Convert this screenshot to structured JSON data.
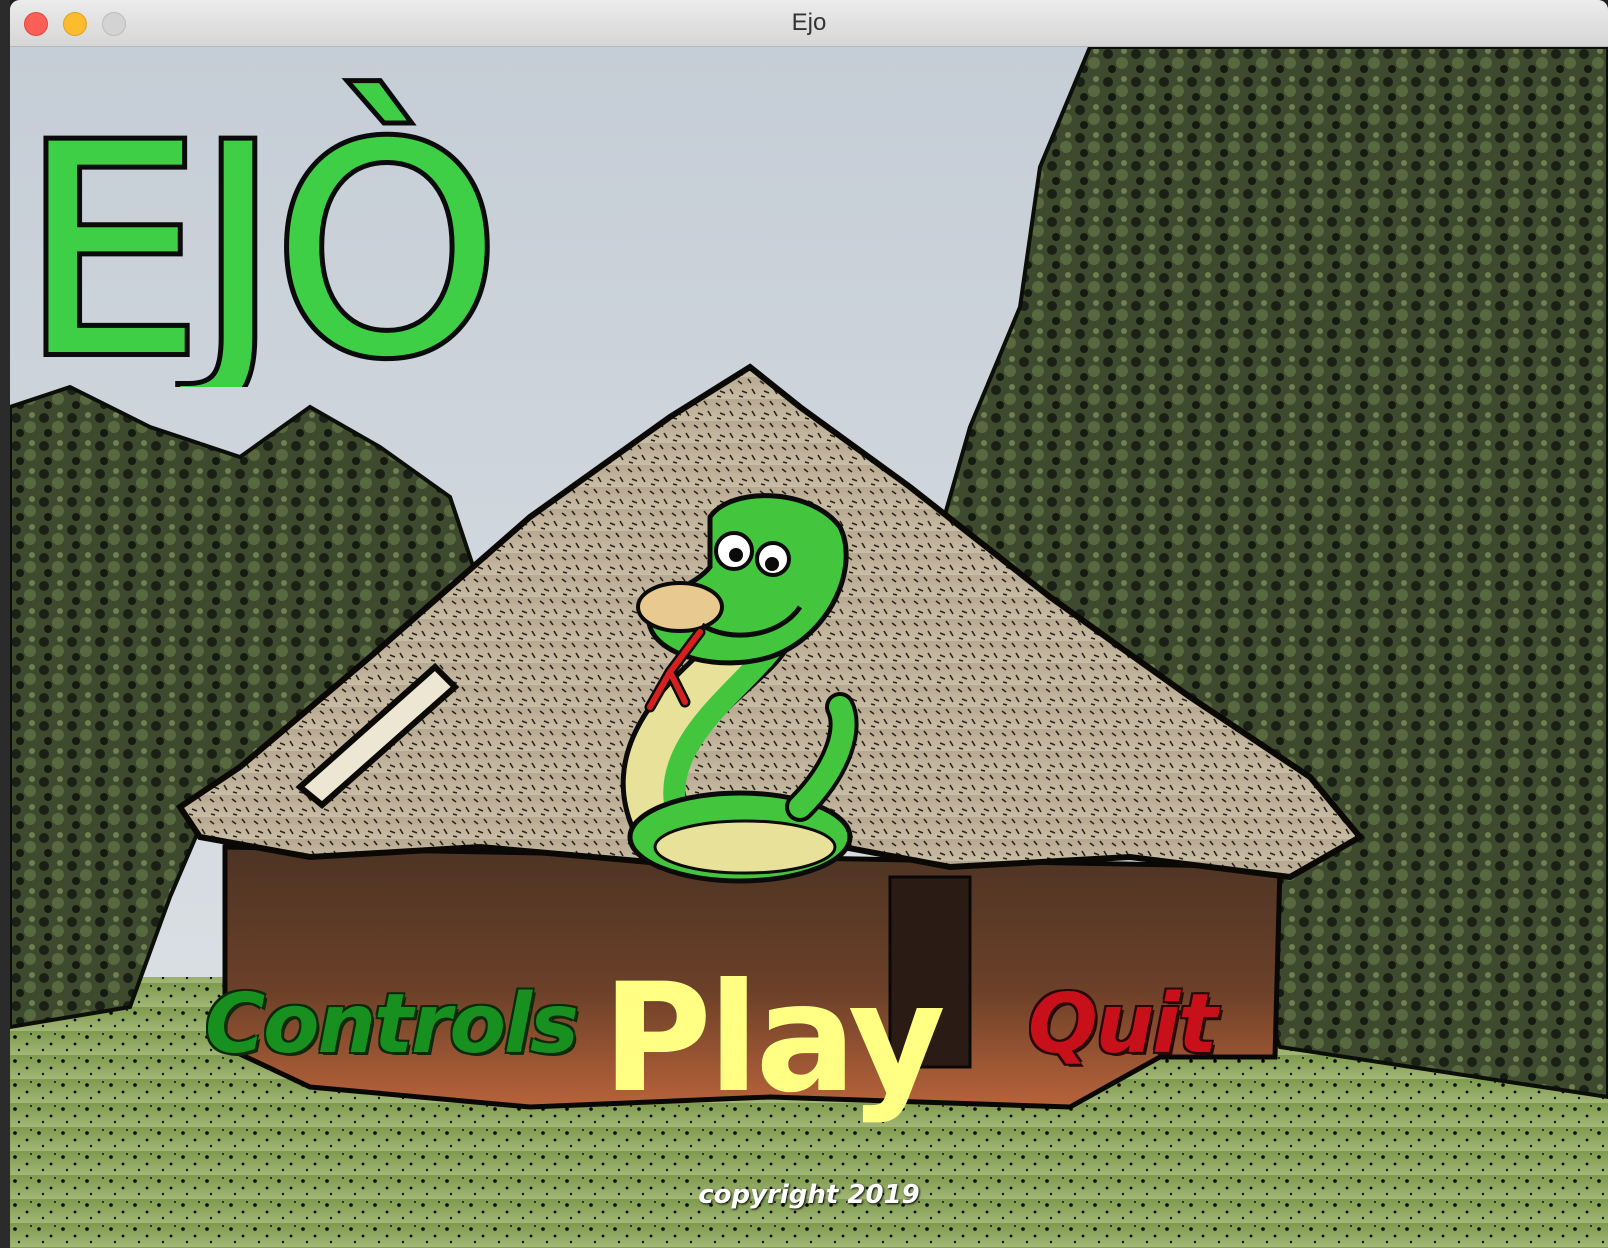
{
  "window": {
    "title": "Ejo"
  },
  "game": {
    "logo_text": "EJÒ",
    "menu": {
      "controls_label": "Controls",
      "play_label": "Play",
      "quit_label": "Quit"
    },
    "copyright": "copyright 2019"
  },
  "colors": {
    "logo_green": "#3fcf47",
    "controls_green": "#17901f",
    "play_yellow": "#ffff84",
    "quit_red": "#c8101a"
  }
}
